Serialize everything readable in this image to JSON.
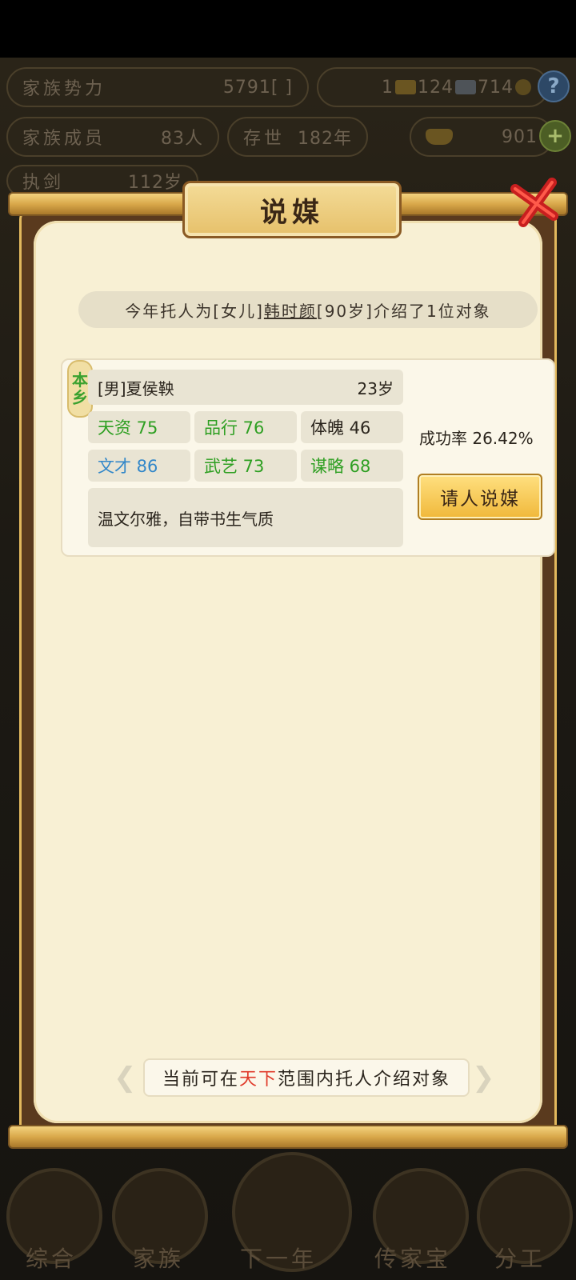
{
  "top": {
    "clan_power_label": "家族势力",
    "clan_power_value": "5791",
    "clan_power_rank": "[ ]",
    "gold_ingots": "1",
    "silver_ingots": "124",
    "coins": "714",
    "members_label": "家族成员",
    "members_value": "83人",
    "generations_label": "存世",
    "generations_value": "182年",
    "yuanbao": "901",
    "head_label": "执剑",
    "head_age": "112岁"
  },
  "modal": {
    "title": "说媒",
    "intro_prefix": "今年托人为[女儿]",
    "intro_name": "韩时颜",
    "intro_suffix": "[90岁]介绍了1位对象",
    "candidate": {
      "origin_line1": "本",
      "origin_line2": "乡",
      "name": "[男]夏侯鞅",
      "age": "23岁",
      "stats": {
        "talent": "天资 75",
        "conduct": "品行 76",
        "physique": "体魄 46",
        "literary": "文才 86",
        "martial": "武艺 73",
        "strategy": "谋略 68"
      },
      "description": "温文尔雅，自带书生气质",
      "success_rate": "成功率 26.42%",
      "button": "请人说媒"
    },
    "footer_prefix": "当前可在",
    "footer_highlight": "天下",
    "footer_suffix": "范围内托人介绍对象"
  },
  "nav": {
    "general": "综合",
    "clan": "家族",
    "next_year": "下一年",
    "heirloom": "传家宝",
    "assign": "分工"
  },
  "colors": {
    "accent_gold": "#f0b83a",
    "green_stat": "#2e9f22",
    "blue_stat": "#3287c9",
    "highlight_red": "#e03a2a"
  }
}
